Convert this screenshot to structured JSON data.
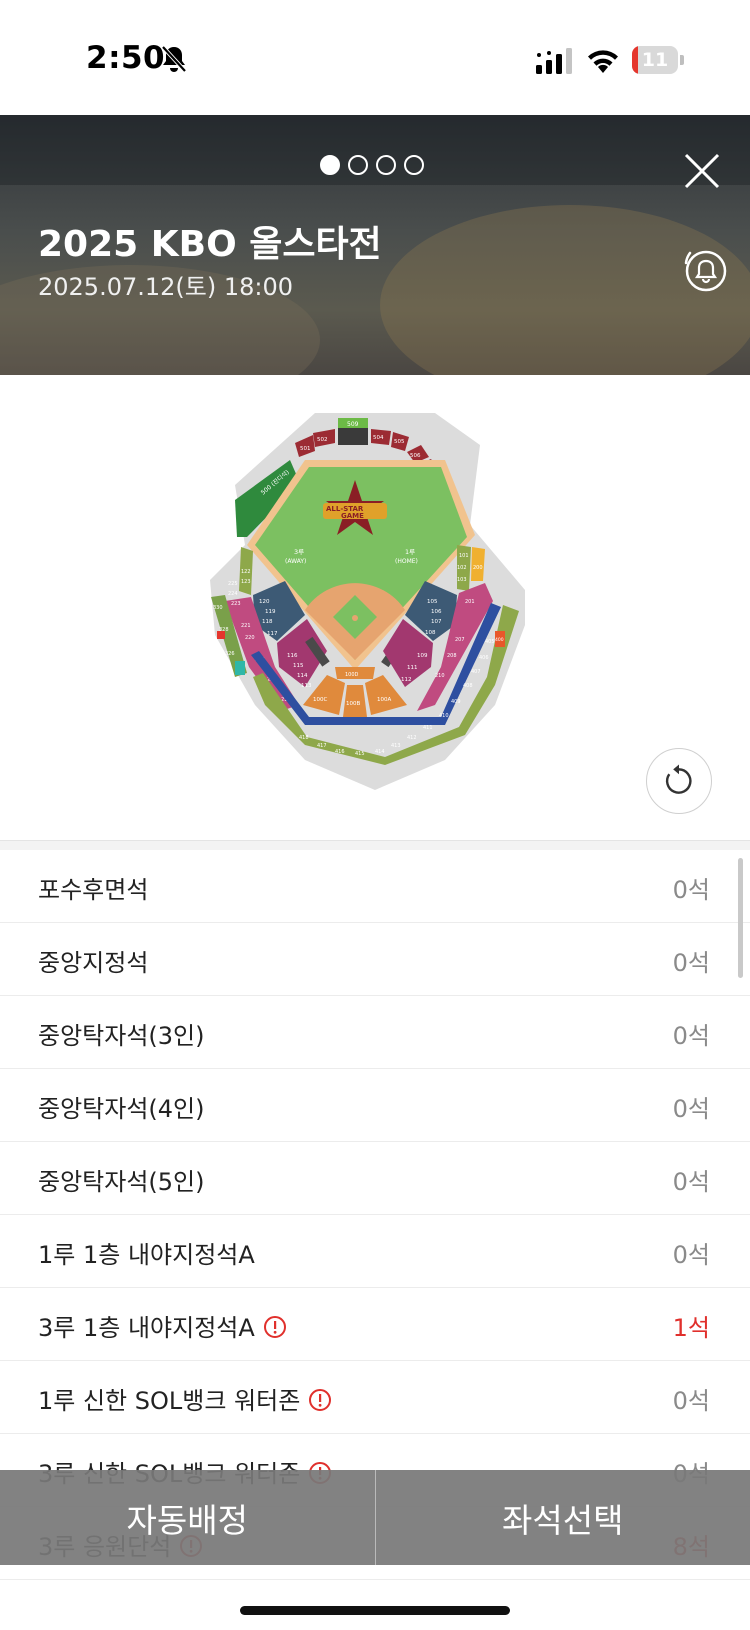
{
  "status_bar": {
    "time": "2:50",
    "battery_level": "11",
    "icons": [
      "bell-slash-icon",
      "cellular-signal-icon",
      "wifi-icon",
      "battery-icon"
    ]
  },
  "header": {
    "title": "2025 KBO 올스타전",
    "date": "2025.07.12(토) 18:00",
    "carousel_total": 4,
    "carousel_active": 1,
    "icons": [
      "close-icon",
      "bell-icon"
    ]
  },
  "stadium_map": {
    "labels": {
      "third_base": "3루",
      "third_base_team": "(AWAY)",
      "first_base": "1루",
      "first_base_team": "(HOME)",
      "logo_line1": "ALL-STAR",
      "logo_line2": "GAME",
      "sections": {
        "s509": "509",
        "s500": "500 (잔디석)",
        "s501": "501",
        "s502": "502",
        "s504": "504",
        "s505": "505",
        "s506": "506",
        "s507": "507",
        "s508": "508",
        "s100a": "100A",
        "s100b": "100B",
        "s100c": "100C",
        "s100d": "100D",
        "s101": "101",
        "s102": "102",
        "s103": "103",
        "s105": "105",
        "s106": "106",
        "s107": "107",
        "s108": "108",
        "s109": "109",
        "s111": "111",
        "s112": "112",
        "s113": "113",
        "s114": "114",
        "s115": "115",
        "s116": "116",
        "s117": "117",
        "s118": "118",
        "s119": "119",
        "s120": "120",
        "s121": "121",
        "s122": "122",
        "s123": "123",
        "s200": "200",
        "s201": "201",
        "s207": "207",
        "s208": "208",
        "s210": "210",
        "s214": "214",
        "s216": "216",
        "s218": "218",
        "s220": "220",
        "s221": "221",
        "s223": "223",
        "s224": "224",
        "s225": "225",
        "s326": "326",
        "s328": "328",
        "s330": "330",
        "s400": "400",
        "s405": "405",
        "s406": "406",
        "s407": "407",
        "s408": "408",
        "s409": "409",
        "s410": "410",
        "s411": "411",
        "s412": "412",
        "s413": "413",
        "s414": "414",
        "s415": "415",
        "s416": "416",
        "s417": "417",
        "s418": "418"
      }
    },
    "colors": {
      "field": "#7cc061",
      "infield_dirt": "#e6a46f",
      "warning_track": "#f1c38e",
      "outfield_lawn": "#2f8a3d",
      "wine_sections": "#9c2b33",
      "navy_sections": "#3d5a75",
      "magenta_sections": "#a2386f",
      "orange_sections": "#e08a3c",
      "olive_sections": "#8ea84a",
      "blue_ring": "#2e4fa0"
    }
  },
  "seat_list": [
    {
      "name": "포수후면석",
      "count": "0석",
      "warning": false,
      "highlight": false
    },
    {
      "name": "중앙지정석",
      "count": "0석",
      "warning": false,
      "highlight": false
    },
    {
      "name": "중앙탁자석(3인)",
      "count": "0석",
      "warning": false,
      "highlight": false
    },
    {
      "name": "중앙탁자석(4인)",
      "count": "0석",
      "warning": false,
      "highlight": false
    },
    {
      "name": "중앙탁자석(5인)",
      "count": "0석",
      "warning": false,
      "highlight": false
    },
    {
      "name": "1루 1층 내야지정석A",
      "count": "0석",
      "warning": false,
      "highlight": false
    },
    {
      "name": "3루 1층 내야지정석A",
      "count": "1석",
      "warning": true,
      "highlight": true
    },
    {
      "name": "1루 신한 SOL뱅크 워터존",
      "count": "0석",
      "warning": true,
      "highlight": false
    },
    {
      "name": "3루 신한 SOL뱅크 워터존",
      "count": "0석",
      "warning": true,
      "highlight": false
    },
    {
      "name": "3루 응원단석",
      "count": "8석",
      "warning": true,
      "highlight": true
    }
  ],
  "bottom_bar": {
    "auto_assign": "자동배정",
    "seat_select": "좌석선택"
  },
  "accent_red": "#e0302c"
}
